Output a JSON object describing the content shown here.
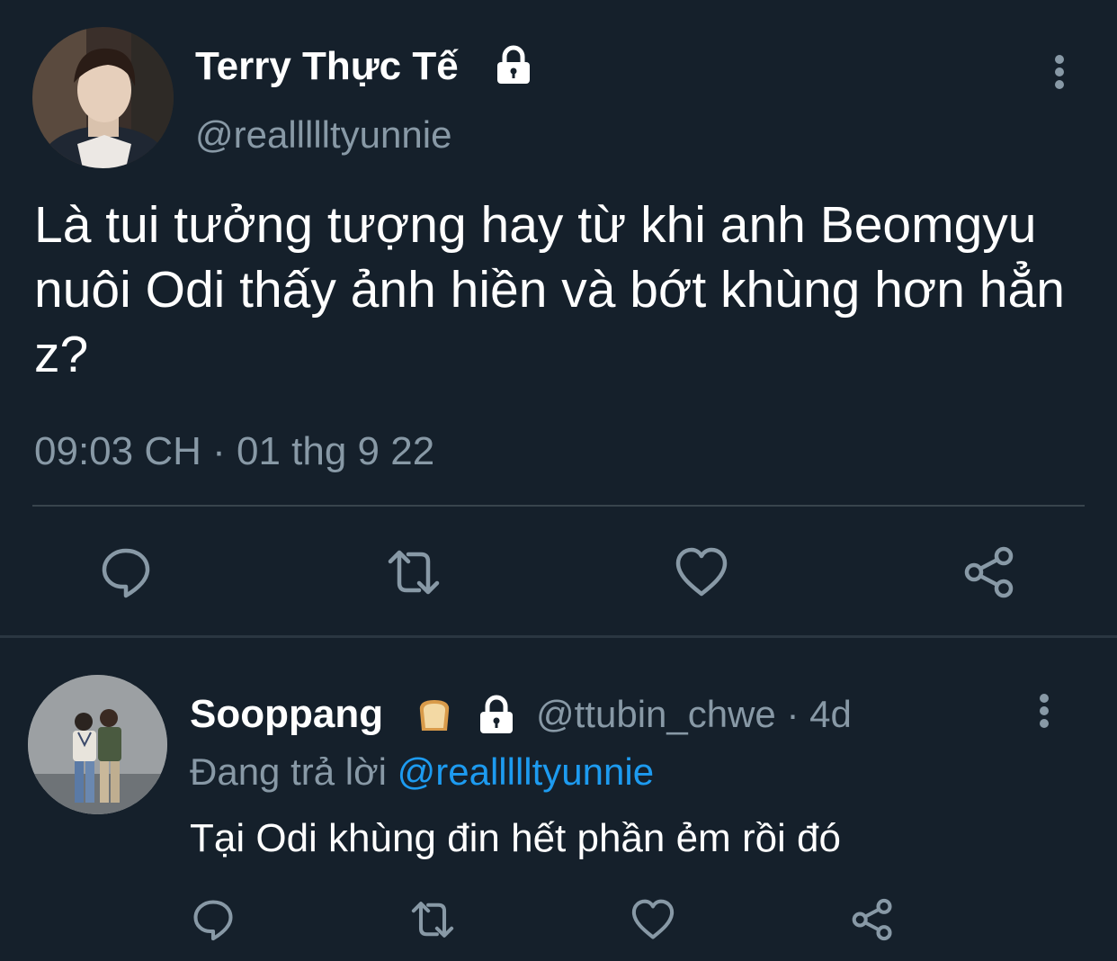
{
  "main_tweet": {
    "display_name": "Terry Thực Tế",
    "handle": "@reallllltyunnie",
    "text": "Là tui tưởng tượng hay từ khi anh Beomgyu nuôi Odi thấy ảnh hiền và bớt khùng hơn hẳn z?",
    "timestamp": "09:03 CH · 01 thg 9 22",
    "locked": true,
    "icons": {
      "lock": "lock-icon",
      "more": "more-vertical-icon",
      "reply": "reply-icon",
      "retweet": "retweet-icon",
      "like": "heart-icon",
      "share": "share-icon"
    }
  },
  "reply": {
    "display_name": "Sooppang",
    "emoji": "bread-icon",
    "handle_time": "@ttubin_chwe · 4d",
    "replying_prefix": "Đang trả lời",
    "replying_to": "@reallllltyunnie",
    "text": "Tại Odi khùng đin hết phần ẻm rồi đó",
    "locked": true
  },
  "colors": {
    "background": "#15202b",
    "text_primary": "#ffffff",
    "text_secondary": "#8899a6",
    "mention": "#1d9bf0",
    "divider": "#38444d"
  }
}
